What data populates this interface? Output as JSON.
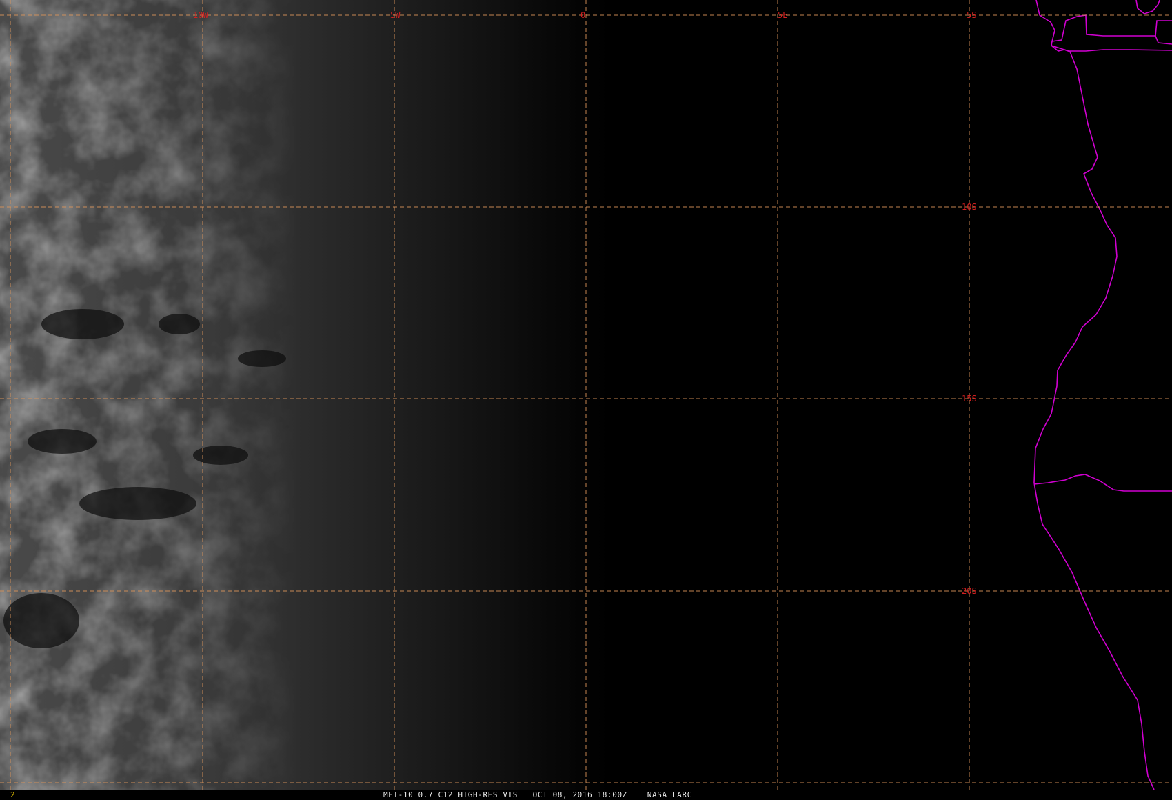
{
  "image": {
    "satellite": "MET-10",
    "channel": "0.7",
    "product": "C12 HIGH-RES VIS",
    "date": "OCT 08, 2016",
    "time": "18:00Z",
    "agency": "NASA LARC",
    "frame_number": "2",
    "caption": "MET-10 0.7 C12 HIGH-RES VIS   OCT 08, 2016 18:00Z    NASA LARC"
  },
  "grid": {
    "longitude_labels": [
      "10W",
      "5W",
      "0",
      "5E"
    ],
    "latitude_labels": [
      "5S",
      "10S",
      "15S",
      "20S"
    ]
  },
  "colors": {
    "grid_line": "#d9935a",
    "grid_label": "#d42020",
    "coastline": "#d100d1",
    "caption_text": "#e8e8e8",
    "frame_number": "#e6c200"
  }
}
